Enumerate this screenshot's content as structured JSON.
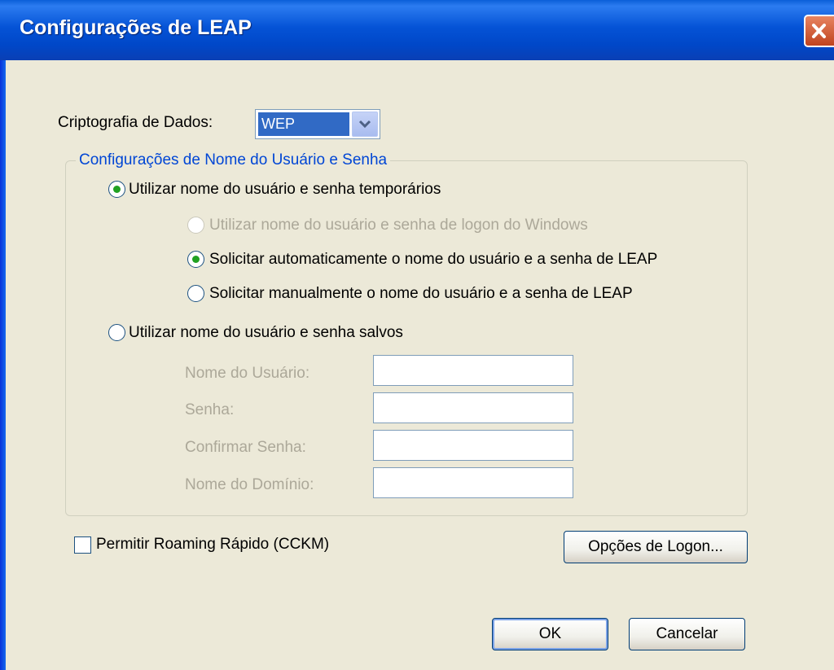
{
  "window": {
    "title": "Configurações de LEAP"
  },
  "encryption": {
    "label": "Criptografia de Dados:",
    "selected": "WEP"
  },
  "group": {
    "label": "Configurações de Nome do Usuário e Senha",
    "option_temp": {
      "label": "Utilizar nome do usuário e senha temporários",
      "checked": true
    },
    "sub_windows": {
      "label": "Utilizar nome do usuário e senha de logon do Windows",
      "checked": false,
      "enabled": false
    },
    "sub_auto": {
      "label": "Solicitar automaticamente o nome do usuário e a senha de LEAP",
      "checked": true
    },
    "sub_manual": {
      "label": "Solicitar manualmente o nome do usuário e a senha de LEAP",
      "checked": false
    },
    "option_saved": {
      "label": "Utilizar nome do usuário e senha salvos",
      "checked": false
    },
    "fields": {
      "username": {
        "label": "Nome do Usuário:",
        "value": ""
      },
      "password": {
        "label": "Senha:",
        "value": ""
      },
      "confirm": {
        "label": "Confirmar Senha:",
        "value": ""
      },
      "domain": {
        "label": "Nome do Domínio:",
        "value": ""
      }
    }
  },
  "fast_roaming": {
    "label": "Permitir Roaming Rápido (CCKM)",
    "checked": false
  },
  "buttons": {
    "logon_options": "Opções de Logon...",
    "ok": "OK",
    "cancel": "Cancelar"
  },
  "colors": {
    "title_bar": "#0553d6",
    "selection": "#316ac5",
    "group_label": "#0046d5",
    "radio_dot": "#21a121",
    "dialog_bg": "#ece9d8"
  }
}
